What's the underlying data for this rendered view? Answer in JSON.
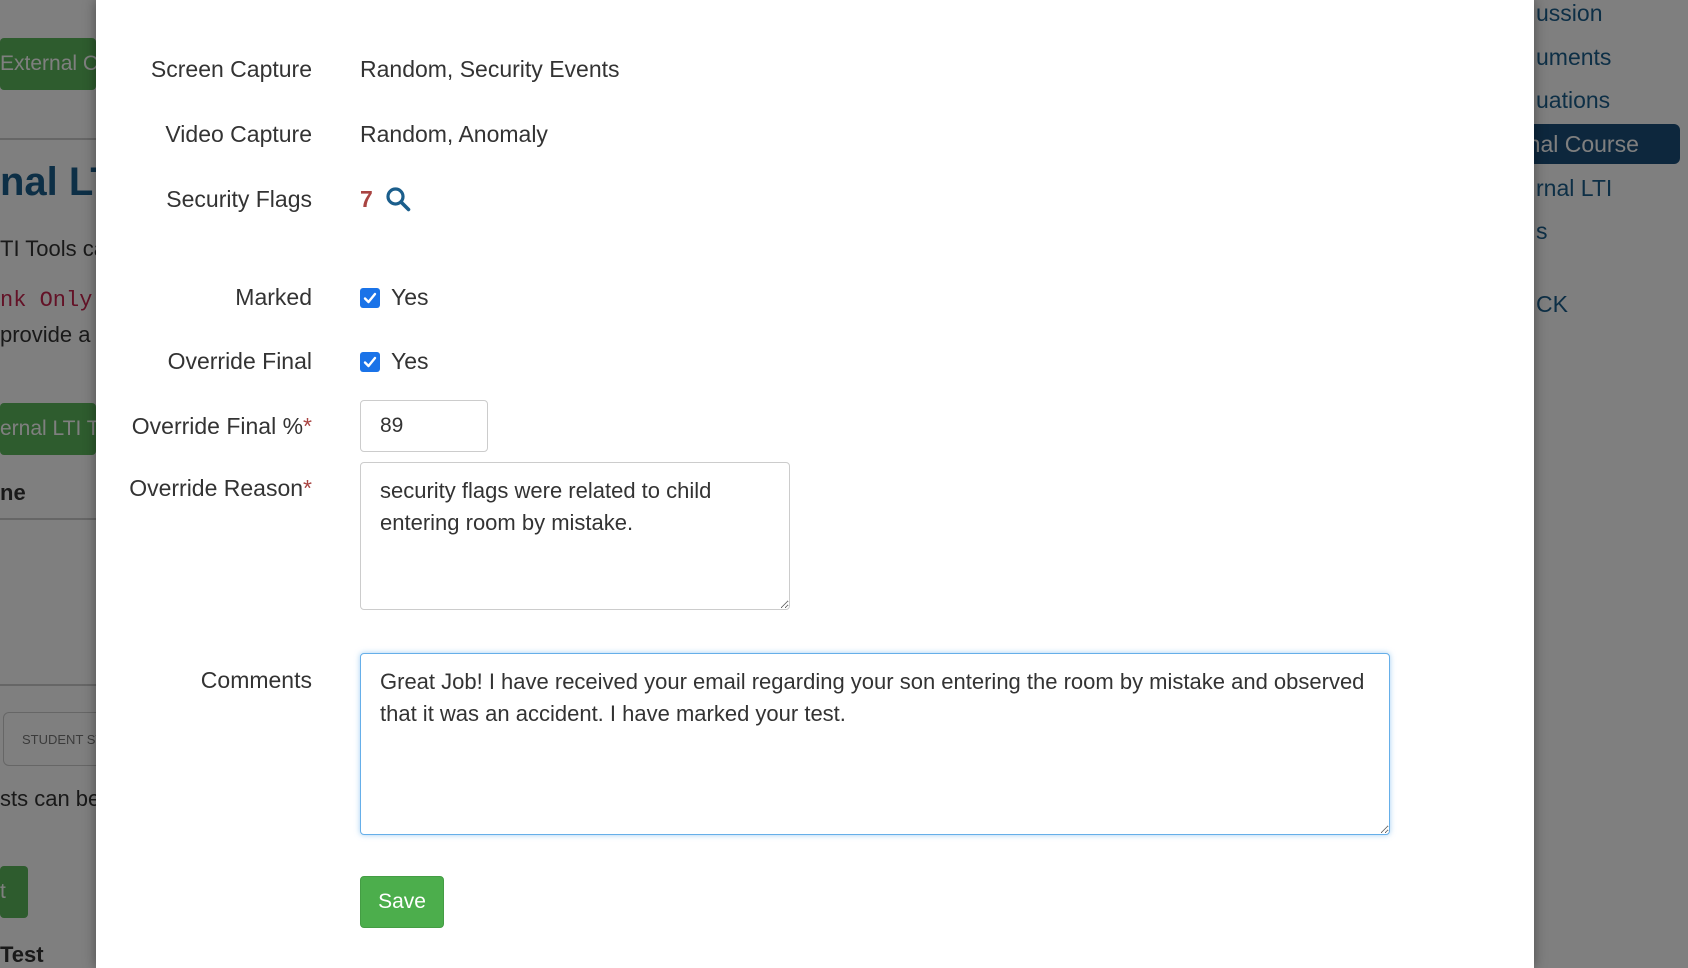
{
  "background": {
    "left_button_top": "External Co",
    "left_heading": "nal LTI",
    "left_text_1": "TI Tools ca",
    "left_code": "nk Only",
    "left_text_2": "provide a l",
    "left_button_mid": "ernal LTI To",
    "left_header": "ne",
    "left_tab": "STUDENT ST",
    "left_text_3": "sts can be",
    "left_button_bottom": "t",
    "left_text_4": "Test",
    "sidebar": {
      "items": [
        {
          "label": "ussion"
        },
        {
          "label": "uments"
        },
        {
          "label": "uations"
        },
        {
          "label": "rnal Course",
          "active": true
        },
        {
          "label": "rnal LTI"
        },
        {
          "label": "s"
        },
        {
          "label": "CK"
        }
      ]
    }
  },
  "modal": {
    "screen_capture": {
      "label": "Screen Capture",
      "value": "Random, Security Events"
    },
    "video_capture": {
      "label": "Video Capture",
      "value": "Random, Anomaly"
    },
    "security_flags": {
      "label": "Security Flags",
      "count": "7",
      "icon": "search-icon"
    },
    "marked": {
      "label": "Marked",
      "checked": true,
      "option_label": "Yes"
    },
    "override_final": {
      "label": "Override Final",
      "checked": true,
      "option_label": "Yes"
    },
    "override_final_pct": {
      "label": "Override Final %",
      "required_mark": "*",
      "value": "89"
    },
    "override_reason": {
      "label": "Override Reason",
      "required_mark": "*",
      "value": "security flags were related to child entering room by mistake."
    },
    "comments": {
      "label": "Comments",
      "value": "Great Job! I have received your email regarding your son entering the room by mistake and observed that it was an accident. I have marked your test."
    },
    "save_label": "Save"
  },
  "colors": {
    "accent_blue": "#1b5e8c",
    "success_green": "#5cb85c",
    "required_red": "#a94442",
    "checkbox_blue": "#1a73e8"
  }
}
